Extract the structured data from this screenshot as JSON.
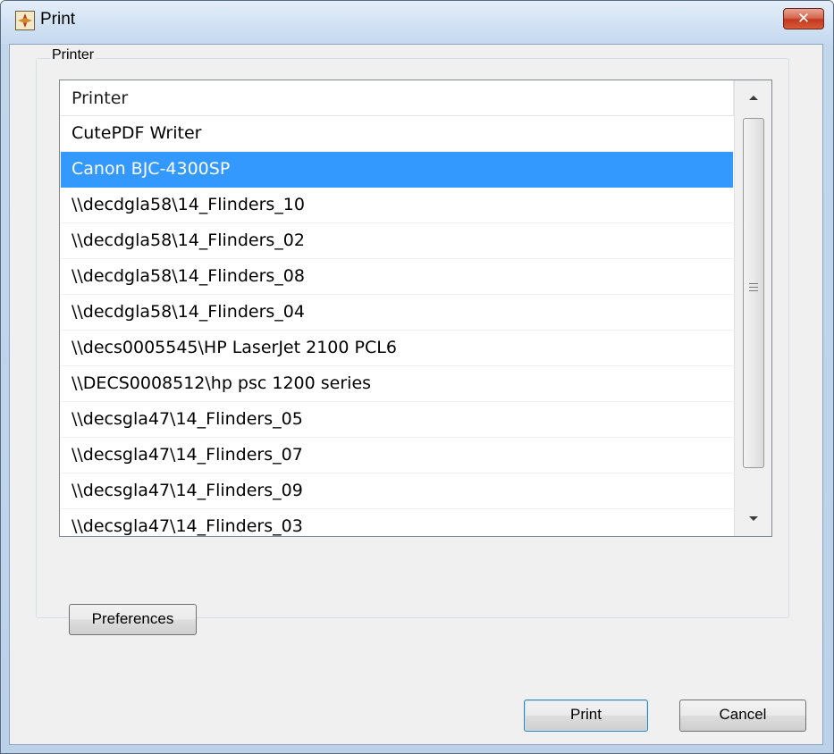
{
  "window": {
    "title": "Print",
    "close_label": "✕"
  },
  "group": {
    "label": "Printer"
  },
  "list": {
    "column_header": "Printer",
    "rows": [
      "CutePDF Writer",
      "Canon BJC-4300SP",
      "\\\\decdgla58\\14_Flinders_10",
      "\\\\decdgla58\\14_Flinders_02",
      "\\\\decdgla58\\14_Flinders_08",
      "\\\\decdgla58\\14_Flinders_04",
      "\\\\decs0005545\\HP LaserJet 2100 PCL6",
      "\\\\DECS0008512\\hp psc 1200 series",
      "\\\\decsgla47\\14_Flinders_05",
      "\\\\decsgla47\\14_Flinders_07",
      "\\\\decsgla47\\14_Flinders_09",
      "\\\\decsgla47\\14_Flinders_03"
    ],
    "selected_index": 1
  },
  "buttons": {
    "preferences": "Preferences",
    "print": "Print",
    "cancel": "Cancel"
  },
  "colors": {
    "selection": "#3399ff",
    "close_button": "#c23a20"
  },
  "icons": {
    "app": "print-app-icon",
    "close": "close-icon",
    "scroll_up": "chevron-up-icon",
    "scroll_down": "chevron-down-icon",
    "scroll_grip": "scroll-grip-icon"
  }
}
